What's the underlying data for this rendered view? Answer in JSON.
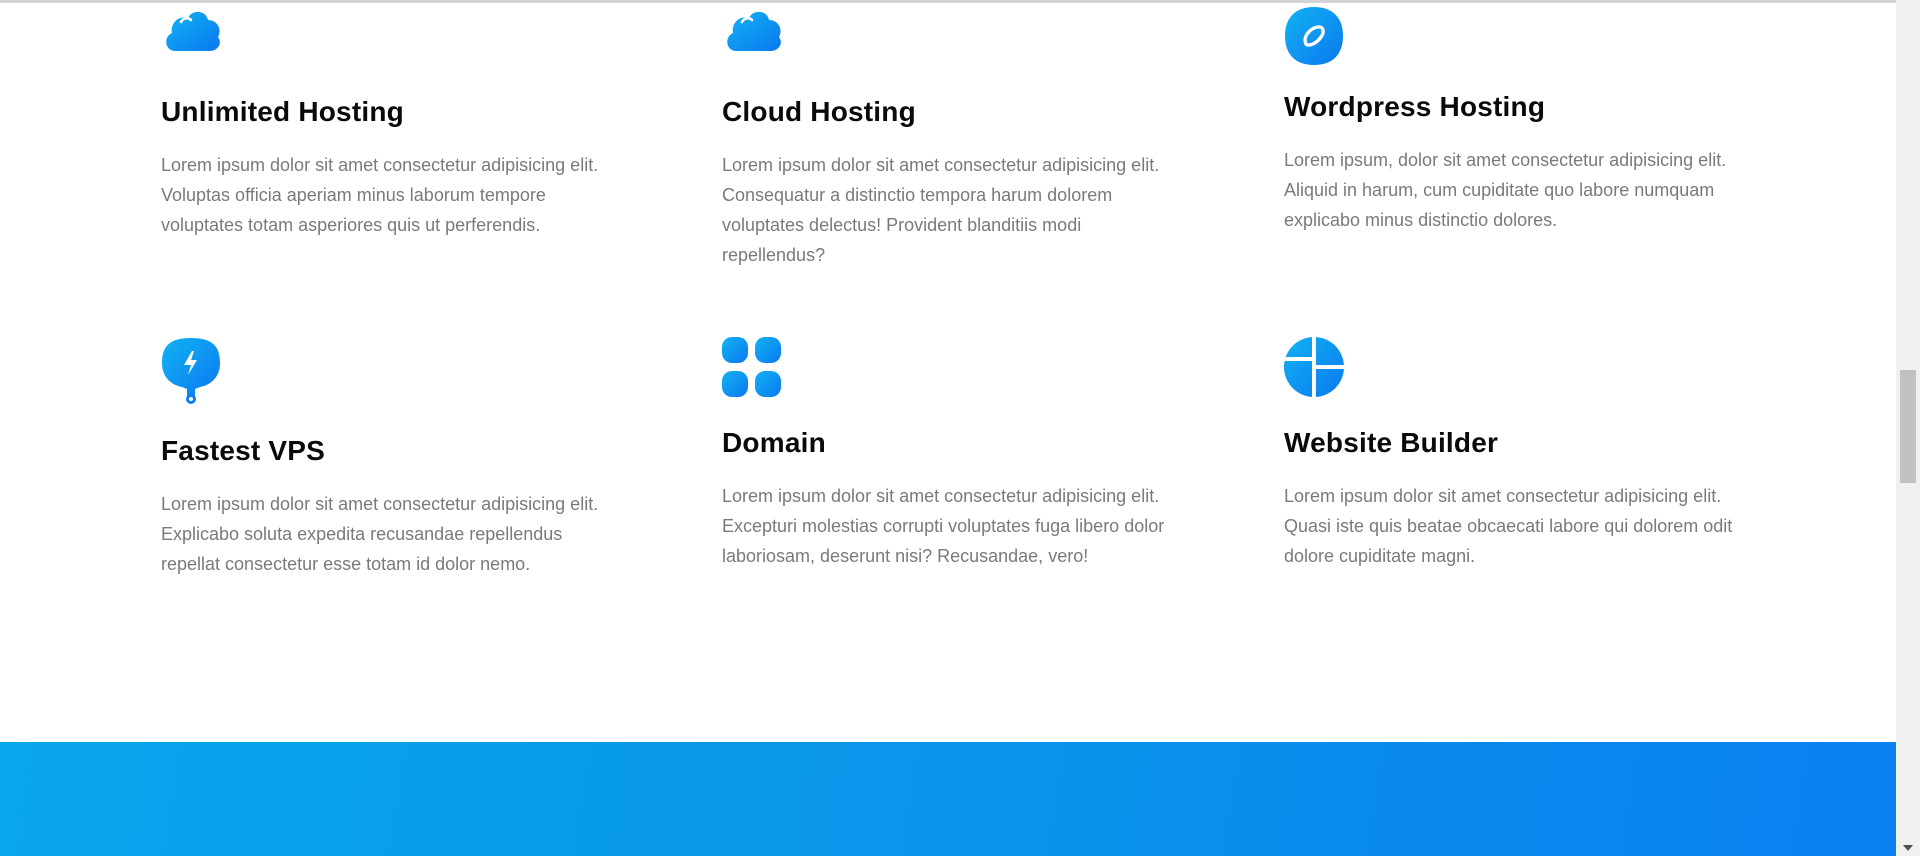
{
  "features": [
    {
      "icon": "cloud-icon",
      "title": "Unlimited Hosting",
      "lines": [
        "Lorem ipsum dolor sit amet consectetur adipisicing elit.",
        "Voluptas officia aperiam minus laborum tempore",
        "voluptates totam asperiores quis ut perferendis."
      ]
    },
    {
      "icon": "cloud-icon",
      "title": "Cloud Hosting",
      "lines": [
        "Lorem ipsum dolor sit amet consectetur adipisicing elit.",
        "Consequatur a distinctio tempora harum dolorem",
        "voluptates delectus! Provident blanditiis modi",
        "repellendus?"
      ]
    },
    {
      "icon": "wordpress-icon",
      "title": "Wordpress Hosting",
      "lines": [
        "Lorem ipsum, dolor sit amet consectetur adipisicing elit.",
        "Aliquid in harum, cum cupiditate quo labore numquam",
        "explicabo minus distinctio dolores."
      ]
    },
    {
      "icon": "lightning-icon",
      "title": "Fastest VPS",
      "lines": [
        "Lorem ipsum dolor sit amet consectetur adipisicing elit.",
        "Explicabo soluta expedita recusandae repellendus",
        "repellat consectetur esse totam id dolor nemo."
      ]
    },
    {
      "icon": "grid-icon",
      "title": "Domain",
      "lines": [
        "Lorem ipsum dolor sit amet consectetur adipisicing elit.",
        "Excepturi molestias corrupti voluptates fuga libero dolor",
        "laboriosam, deserunt nisi? Recusandae, vero!"
      ]
    },
    {
      "icon": "pie-chart-icon",
      "title": "Website Builder",
      "lines": [
        "Lorem ipsum dolor sit amet consectetur adipisicing elit.",
        "Quasi iste quis beatae obcaecati labore qui dolorem odit",
        "dolore cupiditate magni."
      ]
    }
  ],
  "colors": {
    "accent_light": "#12b3f2",
    "accent_dark": "#0a78f0",
    "heading": "#0a0a0a",
    "body_text": "#7a7a7a",
    "band_start": "#08a6ec",
    "band_end": "#0a7ff0"
  }
}
